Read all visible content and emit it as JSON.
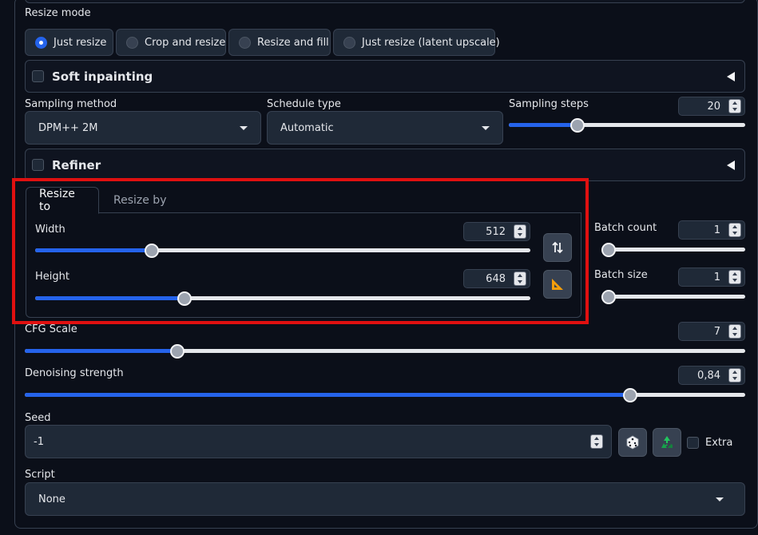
{
  "resize_mode": {
    "label": "Resize mode",
    "options": [
      {
        "label": "Just resize",
        "selected": true
      },
      {
        "label": "Crop and resize",
        "selected": false
      },
      {
        "label": "Resize and fill",
        "selected": false
      },
      {
        "label": "Just resize (latent upscale)",
        "selected": false
      }
    ]
  },
  "soft_inpainting": {
    "label": "Soft inpainting",
    "checked": false
  },
  "sampling_method": {
    "label": "Sampling method",
    "value": "DPM++ 2M"
  },
  "schedule_type": {
    "label": "Schedule type",
    "value": "Automatic"
  },
  "sampling_steps": {
    "label": "Sampling steps",
    "value": "20",
    "fraction": 0.29
  },
  "refiner": {
    "label": "Refiner",
    "checked": false
  },
  "tabs": [
    {
      "label": "Resize to",
      "active": true
    },
    {
      "label": "Resize by",
      "active": false
    }
  ],
  "width": {
    "label": "Width",
    "value": "512",
    "fraction": 0.235
  },
  "height": {
    "label": "Height",
    "value": "648",
    "fraction": 0.301
  },
  "batch_count": {
    "label": "Batch count",
    "value": "1",
    "fraction": 0.0
  },
  "batch_size": {
    "label": "Batch size",
    "value": "1",
    "fraction": 0.0
  },
  "cfg_scale": {
    "label": "CFG Scale",
    "value": "7",
    "fraction": 0.212
  },
  "denoising_strength": {
    "label": "Denoising strength",
    "value": "0,84",
    "fraction": 0.84
  },
  "seed": {
    "label": "Seed",
    "value": "-1",
    "extra_label": "Extra"
  },
  "script": {
    "label": "Script",
    "value": "None"
  },
  "icons": {
    "swap": "swap-dimensions-icon",
    "ruler": "triangle-ruler-icon",
    "dice": "dice-icon",
    "recycle": "recycle-icon"
  },
  "colors": {
    "accent": "#2563eb",
    "highlight_box": "#e01010",
    "background": "#0b0f19"
  }
}
